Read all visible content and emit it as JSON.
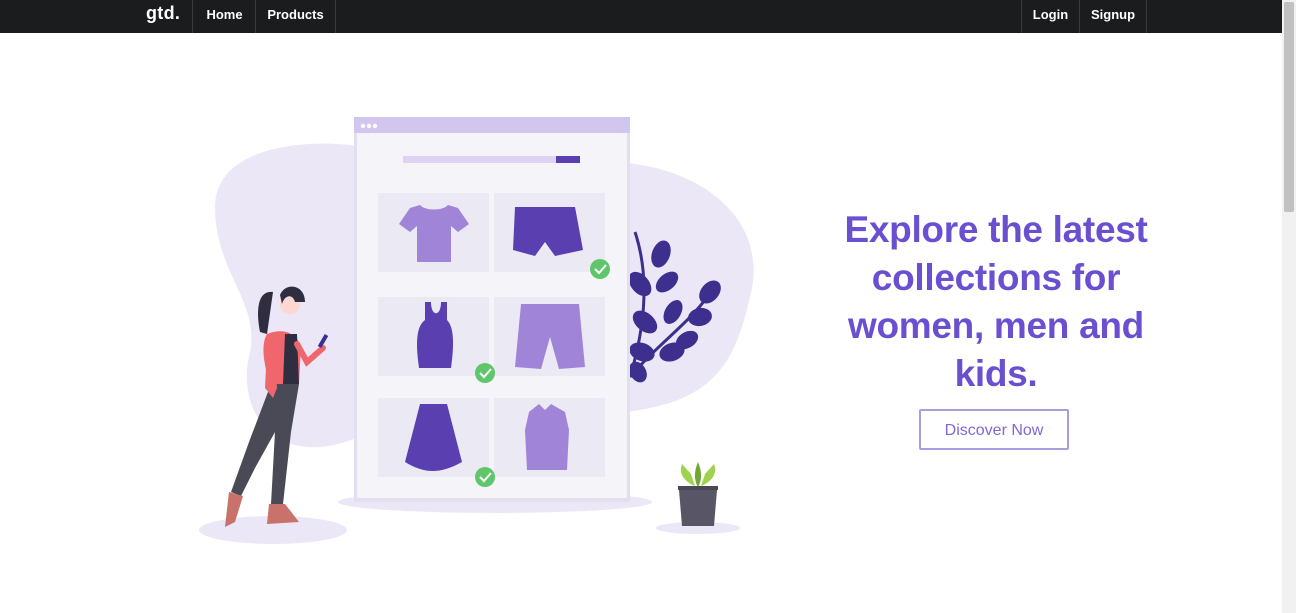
{
  "nav": {
    "brand": "gtd.",
    "left_links": [
      {
        "label": "Home"
      },
      {
        "label": "Products"
      }
    ],
    "right_links": [
      {
        "label": "Login"
      },
      {
        "label": "Signup"
      }
    ]
  },
  "hero": {
    "headline": "Explore the latest collections for women, men and kids.",
    "cta_label": "Discover Now"
  },
  "colors": {
    "navbar": "#1b1c1e",
    "accent": "#6a4fd0",
    "accent_light": "#a084d8",
    "blob": "#ece7f6",
    "check": "#5fc66b"
  },
  "illustration": {
    "icons": [
      "shopping-woman-illustration",
      "shop-window-illustration",
      "tshirt-icon",
      "shorts-icon",
      "tank-top-icon",
      "bermuda-shorts-icon",
      "skirt-icon",
      "vest-icon",
      "check-icon",
      "plant-icon",
      "potted-plant-icon"
    ]
  }
}
